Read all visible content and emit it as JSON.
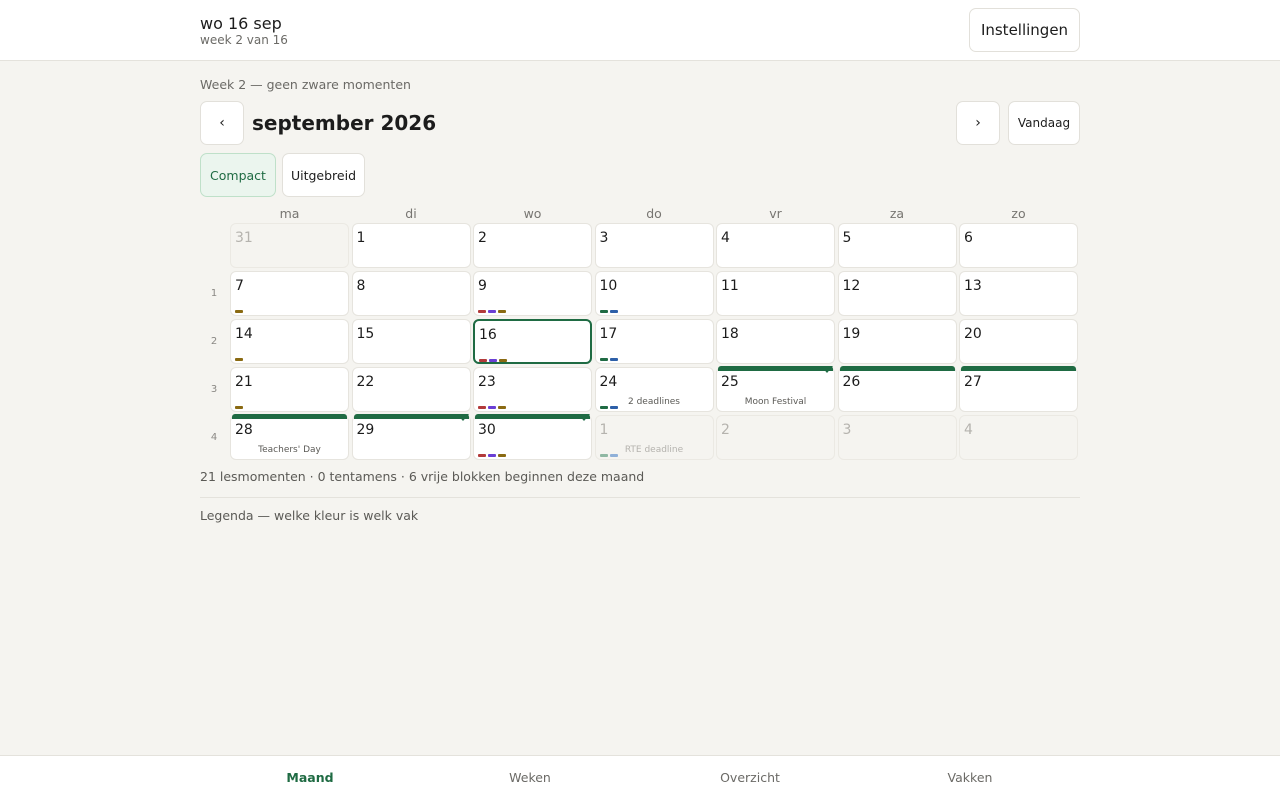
{
  "header": {
    "date": "wo 16 sep",
    "week": "week 2 van 16",
    "settings_label": "Instellingen"
  },
  "week_note": "Week 2 — geen zware momenten",
  "nav": {
    "prev": "‹",
    "next": "›",
    "today": "Vandaag"
  },
  "month_title": "september 2026",
  "view_toggle": {
    "compact": "Compact",
    "extended": "Uitgebreid",
    "selected": "Compact"
  },
  "weekdays": [
    "ma",
    "di",
    "wo",
    "do",
    "vr",
    "za",
    "zo"
  ],
  "colors": {
    "accent": "#1f6b43",
    "subject_colors": [
      "#b23a3a",
      "#6a3fd4",
      "#8a6a12",
      "#1f6b43",
      "#2d5fa8"
    ]
  },
  "calendar": {
    "today": 16,
    "weeks": [
      {
        "week_no": "",
        "days": [
          {
            "day": "31",
            "outside": true
          },
          {
            "day": "1"
          },
          {
            "day": "2"
          },
          {
            "day": "3"
          },
          {
            "day": "4"
          },
          {
            "day": "5"
          },
          {
            "day": "6"
          }
        ]
      },
      {
        "week_no": "1",
        "days": [
          {
            "day": "7",
            "dots": [
              "#8a6a12"
            ]
          },
          {
            "day": "8"
          },
          {
            "day": "9",
            "dots": [
              "#b23a3a",
              "#6a3fd4",
              "#8a6a12"
            ]
          },
          {
            "day": "10",
            "dots": [
              "#1f6b43",
              "#2d5fa8"
            ]
          },
          {
            "day": "11"
          },
          {
            "day": "12"
          },
          {
            "day": "13"
          }
        ]
      },
      {
        "week_no": "2",
        "days": [
          {
            "day": "14",
            "dots": [
              "#8a6a12"
            ]
          },
          {
            "day": "15"
          },
          {
            "day": "16",
            "today": true,
            "dots": [
              "#b23a3a",
              "#6a3fd4",
              "#8a6a12"
            ]
          },
          {
            "day": "17",
            "dots": [
              "#1f6b43",
              "#2d5fa8"
            ]
          },
          {
            "day": "18"
          },
          {
            "day": "19"
          },
          {
            "day": "20"
          }
        ]
      },
      {
        "week_no": "3",
        "days": [
          {
            "day": "21",
            "dots": [
              "#8a6a12"
            ]
          },
          {
            "day": "22"
          },
          {
            "day": "23",
            "dots": [
              "#b23a3a",
              "#6a3fd4",
              "#8a6a12"
            ]
          },
          {
            "day": "24",
            "dots": [
              "#1f6b43",
              "#2d5fa8"
            ],
            "event": "2 deadlines"
          },
          {
            "day": "25",
            "event": "Moon Festival",
            "bar": "end"
          },
          {
            "day": "26",
            "bar": "mid"
          },
          {
            "day": "27",
            "bar": "mid"
          }
        ]
      },
      {
        "week_no": "4",
        "days": [
          {
            "day": "28",
            "event": "Teachers' Day",
            "bar": "mid"
          },
          {
            "day": "29",
            "bar": "end"
          },
          {
            "day": "30",
            "dots": [
              "#b23a3a",
              "#6a3fd4",
              "#8a6a12"
            ],
            "bar": "end"
          },
          {
            "day": "1",
            "outside": true,
            "dots": [
              "#8fb8a3",
              "#8fb0d8"
            ],
            "event": "RTE deadline"
          },
          {
            "day": "2",
            "outside": true
          },
          {
            "day": "3",
            "outside": true
          },
          {
            "day": "4",
            "outside": true
          }
        ]
      }
    ]
  },
  "summary": "21 lesmomenten · 0 tentamens · 6 vrije blokken beginnen deze maand",
  "legend": "Legenda — welke kleur is welk vak",
  "bottom_nav": {
    "active": "Maand",
    "items": [
      "Maand",
      "Weken",
      "Overzicht",
      "Vakken"
    ]
  }
}
